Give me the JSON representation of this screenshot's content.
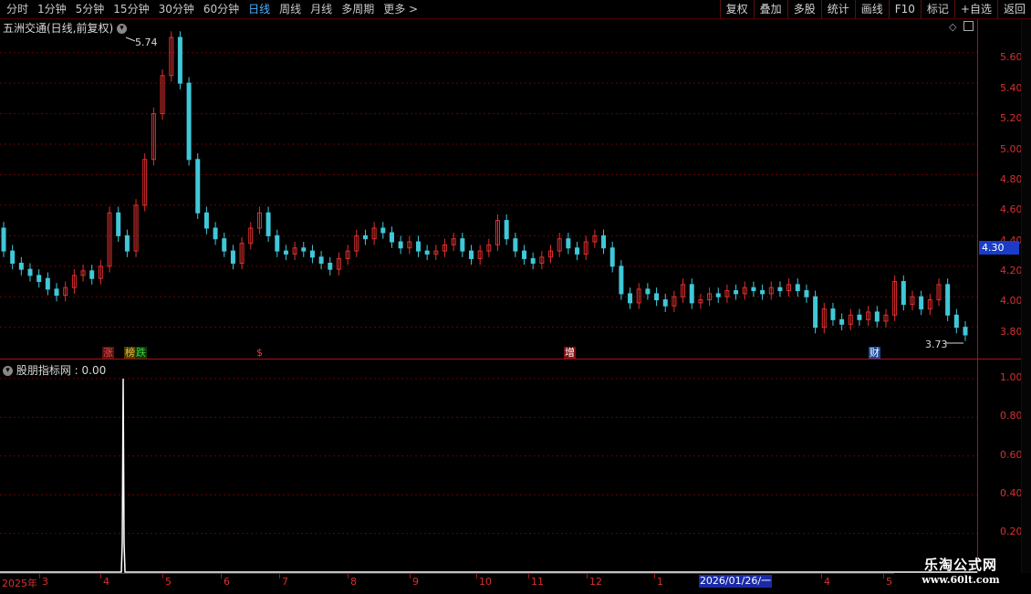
{
  "toolbar": {
    "periods": [
      "分时",
      "1分钟",
      "5分钟",
      "15分钟",
      "30分钟",
      "60分钟",
      "日线",
      "周线",
      "月线",
      "多周期",
      "更多 >"
    ],
    "active_period": "日线",
    "actions": [
      "复权",
      "叠加",
      "多股",
      "统计",
      "画线",
      "F10",
      "标记",
      "+自选",
      "返回"
    ]
  },
  "main": {
    "title": "五洲交通(日线,前复权)",
    "y_ticks": [
      "5.60",
      "5.40",
      "5.20",
      "5.00",
      "4.80",
      "4.60",
      "4.40",
      "4.20",
      "4.00",
      "3.80"
    ],
    "current_price": "4.30",
    "high_label": "5.74",
    "low_label": "3.73",
    "events": [
      {
        "text": "涨",
        "color": "#e05050",
        "bg": "#5a1010"
      },
      {
        "text": "榜",
        "color": "#e0c040",
        "bg": "#4a3a00"
      },
      {
        "text": "跌",
        "color": "#40d040",
        "bg": "#0a3a0a"
      },
      {
        "text": "$",
        "color": "#ff3030",
        "bg": "transparent"
      },
      {
        "text": "增",
        "color": "#ffffff",
        "bg": "#7a1010"
      },
      {
        "text": "财",
        "color": "#ffffff",
        "bg": "#1a4a9a"
      }
    ],
    "up_color": "#e03030",
    "down_color": "#40c8d8"
  },
  "sub": {
    "title": "股朋指标网 : 0.00",
    "y_ticks": [
      "1.00",
      "0.80",
      "0.60",
      "0.40",
      "0.20"
    ]
  },
  "bottom_axis": {
    "labels": [
      "2025年",
      "3",
      "4",
      "5",
      "6",
      "7",
      "8",
      "9",
      "10",
      "11",
      "12",
      "1",
      "4",
      "5"
    ],
    "cursor_date": "2026/01/26/一"
  },
  "watermark": {
    "line1": "乐淘公式网",
    "line2": "www.60lt.com"
  }
}
